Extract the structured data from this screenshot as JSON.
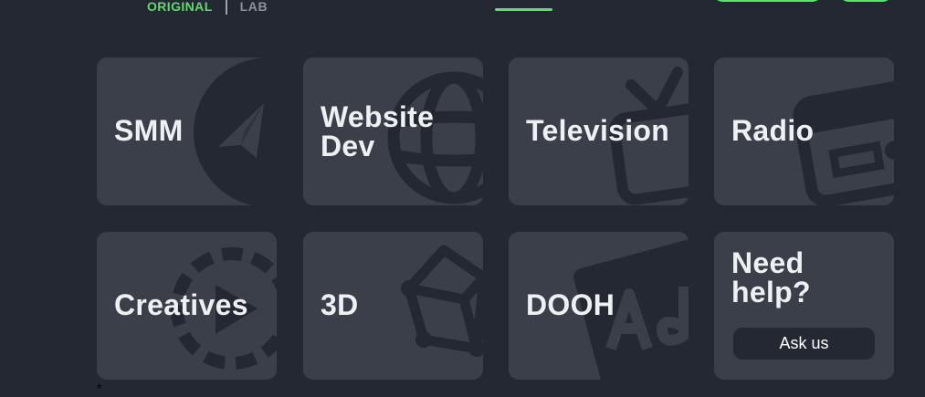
{
  "header": {
    "brand_original": "ORIGINAL",
    "brand_lab": "LAB"
  },
  "services": [
    {
      "label": "SMM",
      "icon": "telegram-icon"
    },
    {
      "label": "Website\nDev",
      "icon": "globe-icon"
    },
    {
      "label": "Television",
      "icon": "tv-icon"
    },
    {
      "label": "Radio",
      "icon": "radio-icon"
    },
    {
      "label": "Creatives",
      "icon": "film-reel-icon"
    },
    {
      "label": "3D",
      "icon": "cube-icon"
    },
    {
      "label": "DOOH",
      "icon": "ad-board-icon"
    }
  ],
  "help": {
    "title": "Need\nhelp?",
    "button": "Ask us"
  },
  "footnote": "*",
  "colors": {
    "background": "#232832",
    "card": "#3a3f4a",
    "icon": "#232832",
    "accent": "#5fe070",
    "text": "#eef0f2"
  }
}
